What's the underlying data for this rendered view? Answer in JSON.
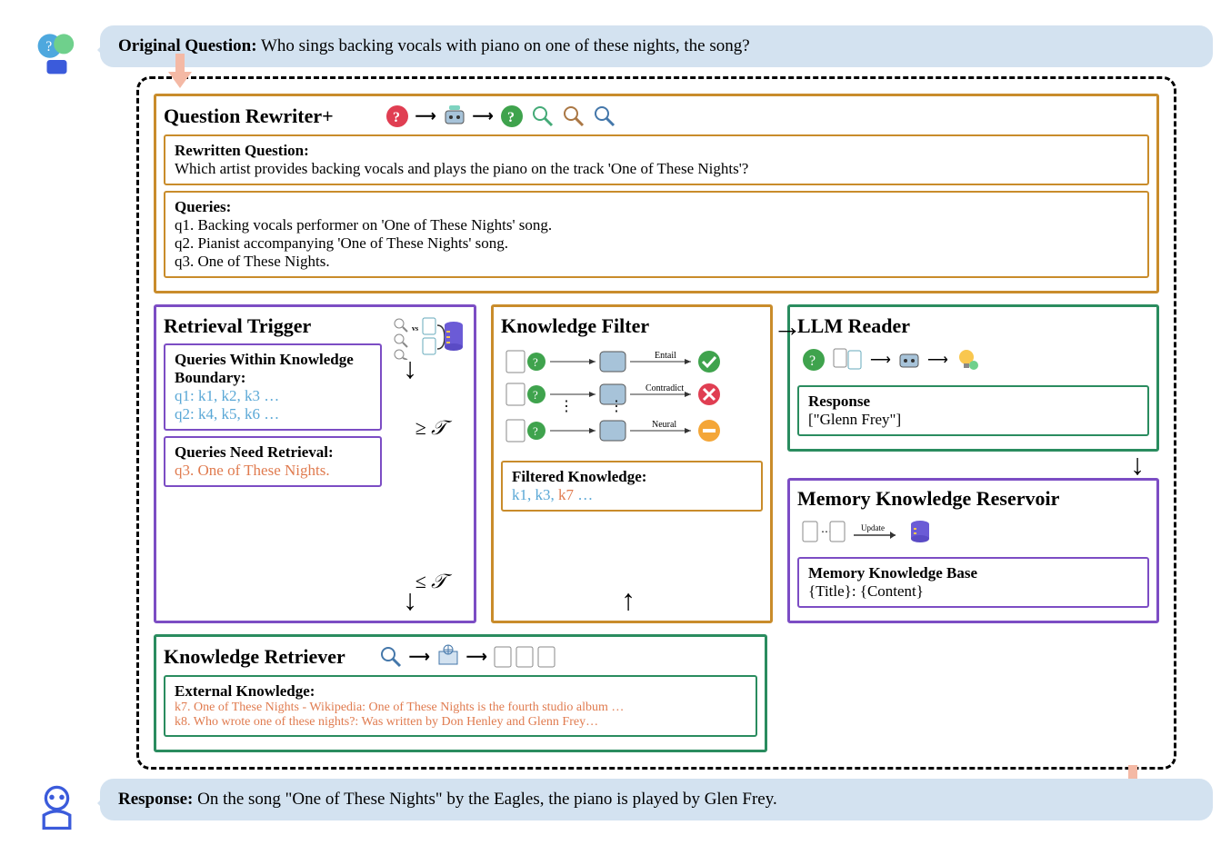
{
  "original_question": {
    "label": "Original Question:",
    "text": "Who sings backing vocals with piano on one of these nights, the song?"
  },
  "rewriter": {
    "title": "Question Rewriter+",
    "rewritten_label": "Rewritten Question:",
    "rewritten_text": "Which artist provides backing vocals and plays the piano on the track 'One of These Nights'?",
    "queries_label": "Queries:",
    "queries": [
      "q1. Backing vocals performer on 'One of These Nights' song.",
      "q2. Pianist accompanying 'One of These Nights' song.",
      "q3. One of These Nights."
    ]
  },
  "trigger": {
    "title": "Retrieval Trigger",
    "within_label": "Queries Within Knowledge Boundary:",
    "within_lines": [
      "q1: k1, k2, k3 …",
      "q2: k4, k5, k6 …"
    ],
    "threshold_ge": "≥ 𝒯",
    "need_label": "Queries Need Retrieval:",
    "need_lines": [
      "q3. One of These Nights."
    ],
    "threshold_le": "≤ 𝒯"
  },
  "retriever": {
    "title": "Knowledge Retriever",
    "label": "External Knowledge:",
    "lines": [
      "k7. One of These Nights - Wikipedia: One of These Nights is the fourth studio album …",
      "k8. Who wrote one of these nights?: Was written by Don Henley and Glenn Frey…"
    ]
  },
  "filter": {
    "title": "Knowledge Filter",
    "labels": {
      "entail": "Entail",
      "contradict": "Contradict",
      "neutral": "Neural"
    },
    "filtered_label": "Filtered Knowledge:",
    "filtered_text_parts": [
      "k1, k3, ",
      "k7",
      " …"
    ]
  },
  "reader": {
    "title": "LLM Reader",
    "response_label": "Response",
    "response_text": "[\"Glenn Frey\"]"
  },
  "memory": {
    "title": "Memory Knowledge Reservoir",
    "update_label": "Update",
    "base_label": "Memory Knowledge Base",
    "base_text": "{Title}: {Content}"
  },
  "final_response": {
    "label": "Response:",
    "text": "On the song \"One of These Nights\" by the Eagles, the piano is played by Glen Frey."
  }
}
